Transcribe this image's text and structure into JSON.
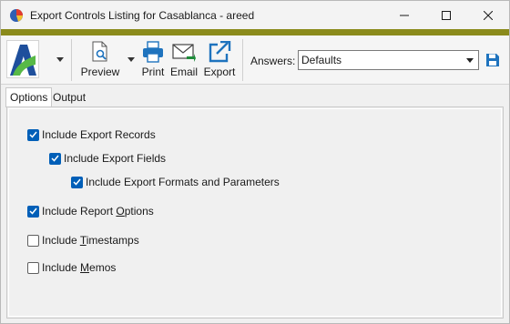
{
  "window": {
    "title": "Export Controls Listing for Casablanca - areed",
    "minimize_glyph": "—",
    "maximize_glyph": "☐",
    "close_glyph": "✕"
  },
  "colors": {
    "accent_bar": "#8b8b1c",
    "checkbox_checked": "#005fb8",
    "icon_blue": "#1e73be",
    "logo_green": "#58b947"
  },
  "toolbar": {
    "preview_label": "Preview",
    "print_label": "Print",
    "email_label": "Email",
    "export_label": "Export",
    "answers_label": "Answers:",
    "answers_value": "Defaults"
  },
  "tabs": [
    {
      "label": "Options",
      "active": true
    },
    {
      "label": "Output",
      "active": false
    }
  ],
  "options": [
    {
      "label_pre": "Include Export Records",
      "mnemonic": "",
      "label_post": "",
      "checked": true,
      "level": 0
    },
    {
      "label_pre": "Include Export Fields",
      "mnemonic": "",
      "label_post": "",
      "checked": true,
      "level": 1
    },
    {
      "label_pre": "Include Export Formats and Parameters",
      "mnemonic": "",
      "label_post": "",
      "checked": true,
      "level": 2
    },
    {
      "label_pre": "Include Report ",
      "mnemonic": "O",
      "label_post": "ptions",
      "checked": true,
      "level": 0
    },
    {
      "label_pre": "Include ",
      "mnemonic": "T",
      "label_post": "imestamps",
      "checked": false,
      "level": 0
    },
    {
      "label_pre": "Include ",
      "mnemonic": "M",
      "label_post": "emos",
      "checked": false,
      "level": 0
    }
  ]
}
